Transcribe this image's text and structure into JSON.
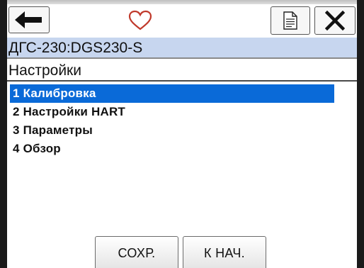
{
  "toolbar": {
    "back_icon": "arrow-left-icon",
    "favorite_icon": "heart-outline-icon",
    "favorite_color": "#c0392b",
    "document_icon": "document-icon",
    "close_icon": "close-x-icon"
  },
  "device": {
    "name": "ДГС-230:DGS230-S",
    "bar_color": "#c7d6ef"
  },
  "menu": {
    "title": "Настройки",
    "selected_color": "#0a6ad8",
    "items": [
      {
        "label": "1 Калибровка",
        "selected": true
      },
      {
        "label": "2 Настройки HART",
        "selected": false
      },
      {
        "label": "3 Параметры",
        "selected": false
      },
      {
        "label": "4 Обзор",
        "selected": false
      }
    ]
  },
  "footer": {
    "save_label": "СОХР.",
    "home_label": "К НАЧ."
  }
}
